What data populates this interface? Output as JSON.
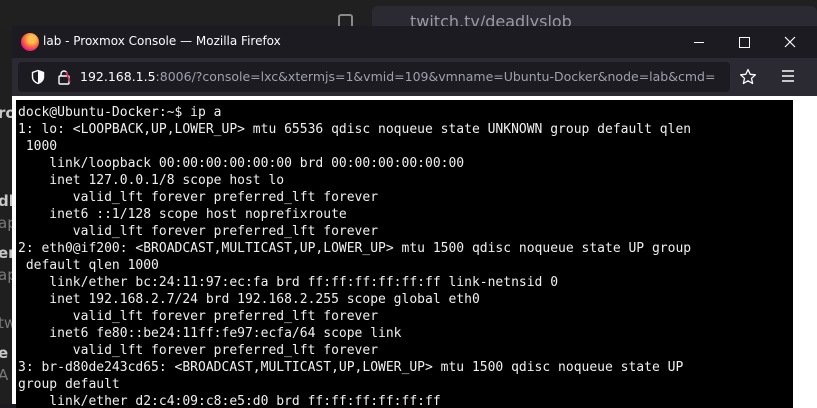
{
  "background": {
    "tab_title": "twitch.tv/deadlyslob",
    "side_letters": [
      "ro",
      "dl",
      "ap",
      "er",
      "ap",
      " ",
      "tw",
      "e",
      "A"
    ]
  },
  "window": {
    "title": "lab - Proxmox Console — Mozilla Firefox",
    "minimize_label": "Minimize",
    "maximize_label": "Maximize",
    "close_label": "Close"
  },
  "urlbar": {
    "host": "192.168.1.5",
    "rest": ":8006/?console=lxc&xtermjs=1&vmid=109&vmname=Ubuntu-Docker&node=lab&cmd="
  },
  "icons": {
    "shield": "shield-icon",
    "lock": "lock-icon",
    "star": "star-icon",
    "menu": "hamburger-menu-icon"
  },
  "colors": {
    "terminal_bg": "#000000",
    "terminal_fg": "#f0f0f0",
    "chrome_bg": "#1c1b22",
    "toolbar_bg": "#2b2a33"
  },
  "terminal": {
    "lines": [
      "dock@Ubuntu-Docker:~$ ip a",
      "1: lo: <LOOPBACK,UP,LOWER_UP> mtu 65536 qdisc noqueue state UNKNOWN group default qlen",
      " 1000",
      "    link/loopback 00:00:00:00:00:00 brd 00:00:00:00:00:00",
      "    inet 127.0.0.1/8 scope host lo",
      "       valid_lft forever preferred_lft forever",
      "    inet6 ::1/128 scope host noprefixroute",
      "       valid_lft forever preferred_lft forever",
      "2: eth0@if200: <BROADCAST,MULTICAST,UP,LOWER_UP> mtu 1500 qdisc noqueue state UP group",
      " default qlen 1000",
      "    link/ether bc:24:11:97:ec:fa brd ff:ff:ff:ff:ff:ff link-netnsid 0",
      "    inet 192.168.2.7/24 brd 192.168.2.255 scope global eth0",
      "       valid_lft forever preferred_lft forever",
      "    inet6 fe80::be24:11ff:fe97:ecfa/64 scope link",
      "       valid_lft forever preferred_lft forever",
      "3: br-d80de243cd65: <BROADCAST,MULTICAST,UP,LOWER_UP> mtu 1500 qdisc noqueue state UP",
      "group default",
      "    link/ether d2:c4:09:c8:e5:d0 brd ff:ff:ff:ff:ff:ff"
    ]
  }
}
